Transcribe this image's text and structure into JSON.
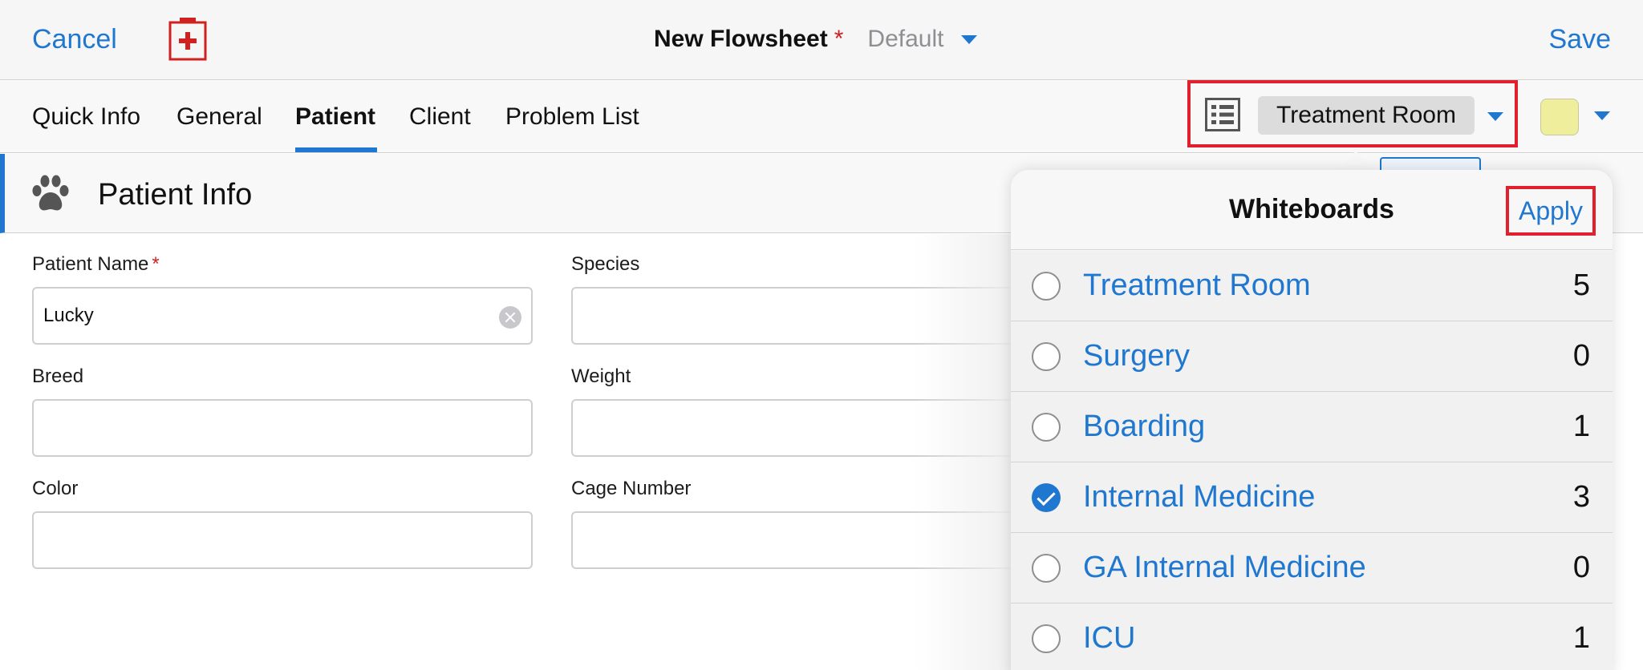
{
  "header": {
    "cancel_label": "Cancel",
    "title": "New Flowsheet",
    "required_marker": "*",
    "template_label": "Default",
    "save_label": "Save"
  },
  "tabs": [
    {
      "label": "Quick Info"
    },
    {
      "label": "General"
    },
    {
      "label": "Patient",
      "active": true
    },
    {
      "label": "Client"
    },
    {
      "label": "Problem List"
    }
  ],
  "whiteboard_selector": {
    "selected": "Treatment Room",
    "color_swatch": "#eeee9c"
  },
  "section": {
    "title": "Patient Info"
  },
  "form": {
    "patient_name": {
      "label": "Patient Name",
      "required_marker": "*",
      "value": "Lucky"
    },
    "species": {
      "label": "Species",
      "value": ""
    },
    "breed": {
      "label": "Breed",
      "value": ""
    },
    "weight": {
      "label": "Weight",
      "value": ""
    },
    "color": {
      "label": "Color",
      "value": ""
    },
    "cage_number": {
      "label": "Cage Number",
      "value": ""
    }
  },
  "popover": {
    "title": "Whiteboards",
    "apply_label": "Apply",
    "items": [
      {
        "name": "Treatment Room",
        "count": "5",
        "checked": false
      },
      {
        "name": "Surgery",
        "count": "0",
        "checked": false
      },
      {
        "name": "Boarding",
        "count": "1",
        "checked": false
      },
      {
        "name": "Internal Medicine",
        "count": "3",
        "checked": true
      },
      {
        "name": "GA Internal Medicine",
        "count": "0",
        "checked": false
      },
      {
        "name": "ICU",
        "count": "1",
        "checked": false
      }
    ]
  },
  "colors": {
    "accent": "#1f77d0",
    "highlight_border": "#e0202c",
    "required": "#d02020"
  }
}
